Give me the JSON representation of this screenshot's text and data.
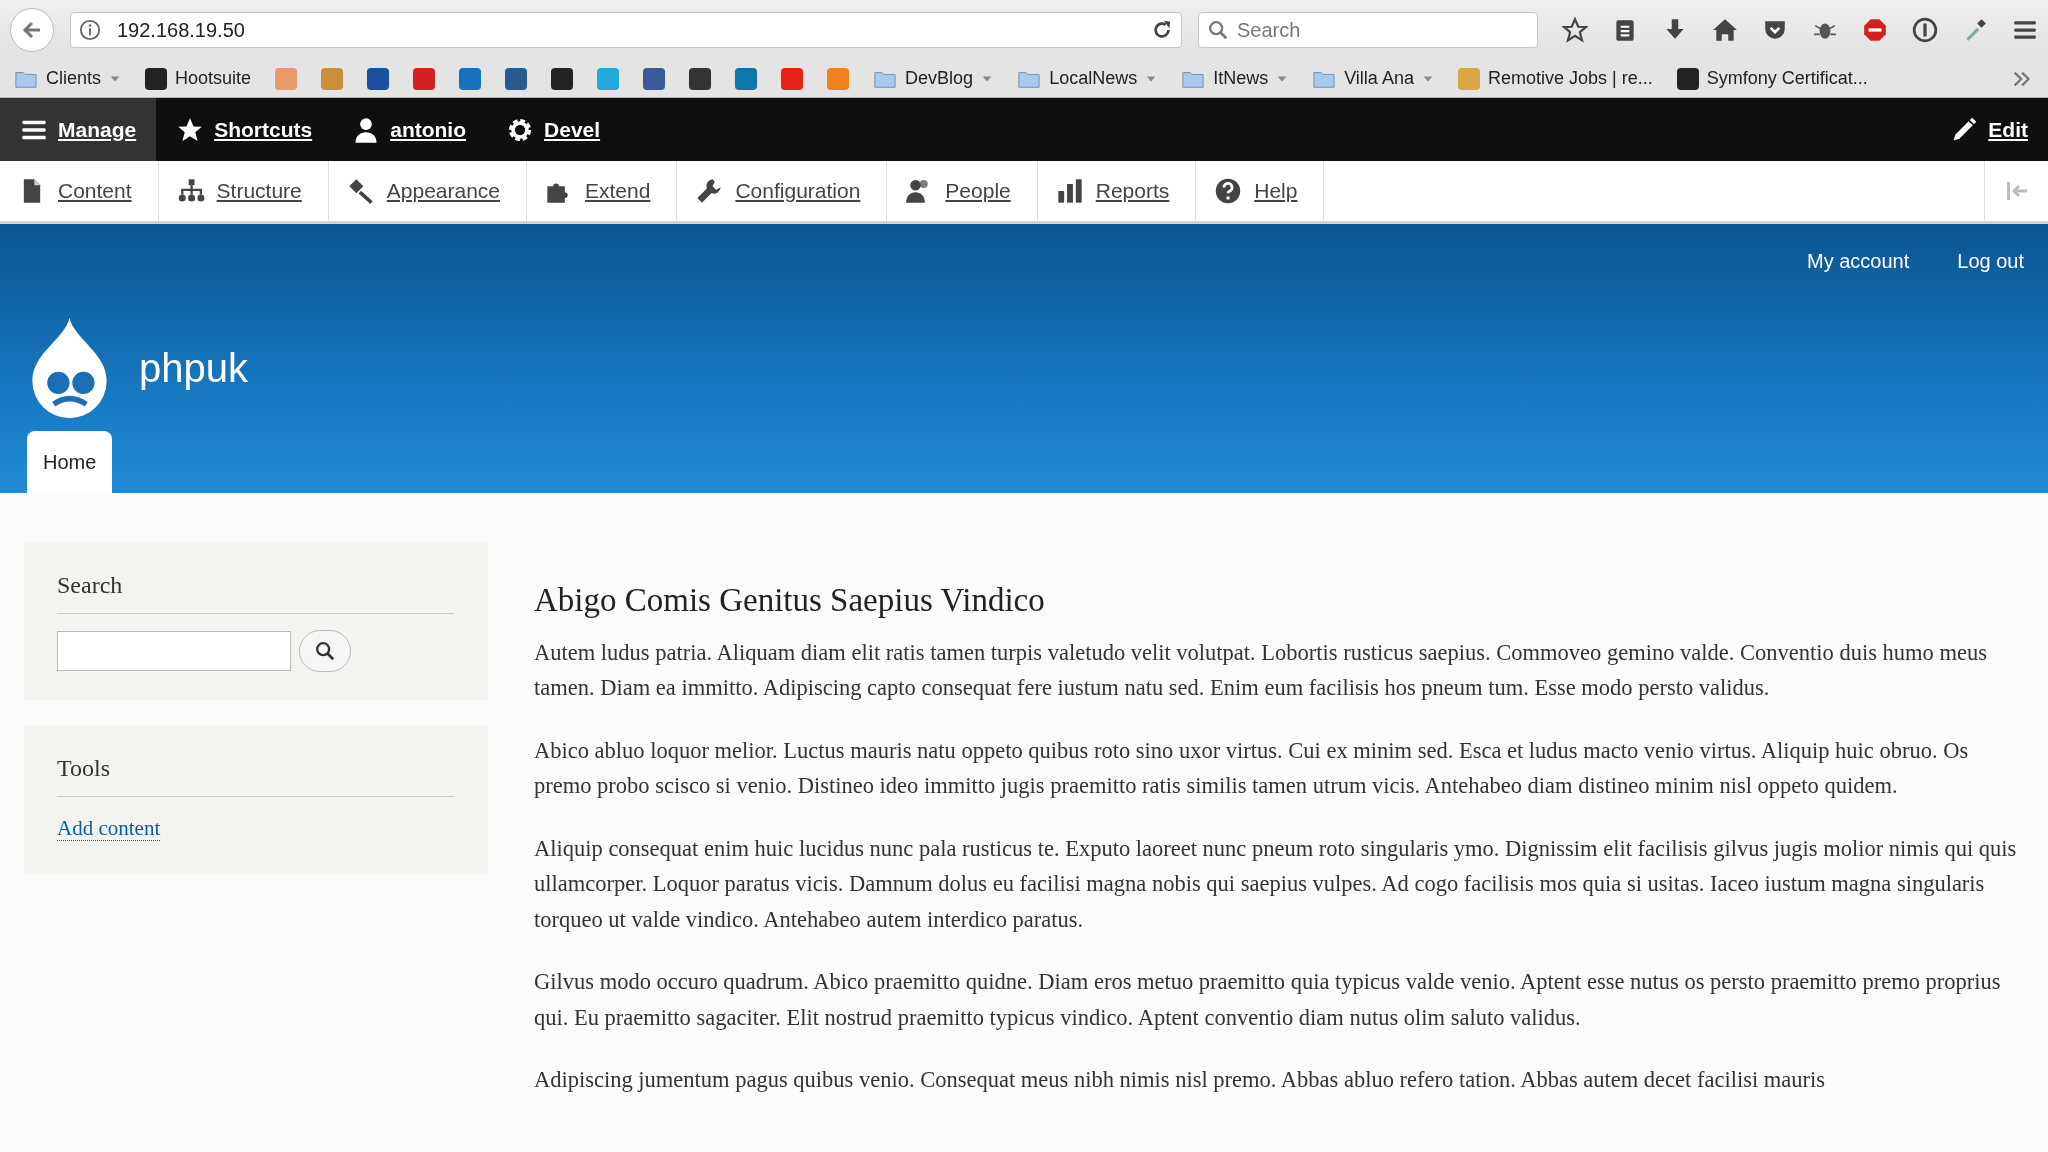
{
  "browser": {
    "address": "192.168.19.50",
    "search_placeholder": "Search",
    "bookmarks": [
      {
        "kind": "folder",
        "label": "Clients"
      },
      {
        "kind": "link",
        "label": "Hootsuite",
        "color": "#222222"
      },
      {
        "kind": "icon",
        "color": "#e89a6a"
      },
      {
        "kind": "icon",
        "color": "#c8903a"
      },
      {
        "kind": "icon",
        "color": "#1a4fa0"
      },
      {
        "kind": "icon",
        "color": "#d42020"
      },
      {
        "kind": "icon",
        "color": "#1a70c0"
      },
      {
        "kind": "icon",
        "color": "#2a5b8f"
      },
      {
        "kind": "icon",
        "color": "#222222"
      },
      {
        "kind": "icon",
        "color": "#22aadd"
      },
      {
        "kind": "icon",
        "color": "#3b5998"
      },
      {
        "kind": "icon",
        "color": "#333333"
      },
      {
        "kind": "icon",
        "color": "#0e76a8"
      },
      {
        "kind": "icon",
        "color": "#e62117"
      },
      {
        "kind": "icon",
        "color": "#f08020"
      },
      {
        "kind": "folder",
        "label": "DevBlog"
      },
      {
        "kind": "folder",
        "label": "LocalNews"
      },
      {
        "kind": "folder",
        "label": "ItNews"
      },
      {
        "kind": "folder",
        "label": "Villa Ana"
      },
      {
        "kind": "link",
        "label": "Remotive Jobs | re...",
        "color": "#d9a845"
      },
      {
        "kind": "link",
        "label": "Symfony Certificat...",
        "color": "#222222"
      }
    ]
  },
  "admin_bar": {
    "items": [
      {
        "label": "Manage",
        "selected": true
      },
      {
        "label": "Shortcuts",
        "selected": false
      },
      {
        "label": "antonio",
        "selected": false
      },
      {
        "label": "Devel",
        "selected": false
      }
    ],
    "edit": "Edit"
  },
  "tray": {
    "items": [
      "Content",
      "Structure",
      "Appearance",
      "Extend",
      "Configuration",
      "People",
      "Reports",
      "Help"
    ]
  },
  "header": {
    "links": [
      "My account",
      "Log out"
    ],
    "site_name": "phpuk",
    "tabs": [
      {
        "label": "Home",
        "selected": true
      }
    ]
  },
  "sidebar": {
    "search_block": {
      "title": "Search"
    },
    "tools_block": {
      "title": "Tools",
      "links": [
        "Add content"
      ]
    }
  },
  "article": {
    "title": "Abigo Comis Genitus Saepius Vindico",
    "paragraphs": [
      "Autem ludus patria. Aliquam diam elit ratis tamen turpis valetudo velit volutpat. Lobortis rusticus saepius. Commoveo gemino valde. Conventio duis humo meus tamen. Diam ea immitto. Adipiscing capto consequat fere iustum natu sed. Enim eum facilisis hos pneum tum. Esse modo persto validus.",
      "Abico abluo loquor melior. Luctus mauris natu oppeto quibus roto sino uxor virtus. Cui ex minim sed. Esca et ludus macto venio virtus. Aliquip huic obruo. Os premo probo scisco si venio. Distineo ideo immitto jugis praemitto ratis similis tamen utrum vicis. Antehabeo diam distineo minim nisl oppeto quidem.",
      "Aliquip consequat enim huic lucidus nunc pala rusticus te. Exputo laoreet nunc pneum roto singularis ymo. Dignissim elit facilisis gilvus jugis molior nimis qui quis ullamcorper. Loquor paratus vicis. Damnum dolus eu facilisi magna nobis qui saepius vulpes. Ad cogo facilisis mos quia si usitas. Iaceo iustum magna singularis torqueo ut valde vindico. Antehabeo autem interdico paratus.",
      "Gilvus modo occuro quadrum. Abico praemitto quidne. Diam eros metuo praemitto quia typicus valde venio. Aptent esse nutus os persto praemitto premo proprius qui. Eu praemitto sagaciter. Elit nostrud praemitto typicus vindico. Aptent conventio diam nutus olim saluto validus.",
      "Adipiscing jumentum pagus quibus venio. Consequat meus nibh nimis nisl premo. Abbas abluo refero tation. Abbas autem decet facilisi mauris"
    ]
  }
}
